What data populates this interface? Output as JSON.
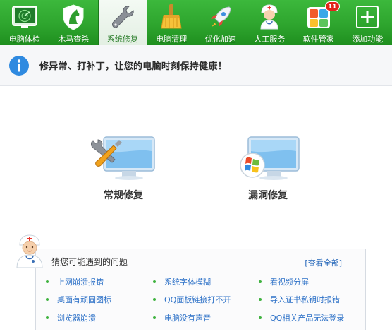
{
  "toolbar": {
    "items": [
      {
        "label": "电脑体检",
        "icon": "radar-monitor-icon"
      },
      {
        "label": "木马查杀",
        "icon": "horse-shield-icon"
      },
      {
        "label": "系统修复",
        "icon": "wrench-icon"
      },
      {
        "label": "电脑清理",
        "icon": "broom-icon"
      },
      {
        "label": "优化加速",
        "icon": "rocket-icon"
      },
      {
        "label": "人工服务",
        "icon": "doctor-icon"
      },
      {
        "label": "软件管家",
        "icon": "app-grid-icon",
        "badge": "11"
      },
      {
        "label": "添加功能",
        "icon": "plus-icon"
      }
    ],
    "active_index": 2
  },
  "info_bar": {
    "icon": "info-icon",
    "text": "修异常、打补丁，让您的电脑时刻保持健康！"
  },
  "repair_options": {
    "normal": {
      "label": "常规修复",
      "icon": "monitor-tools-icon"
    },
    "vulnerability": {
      "label": "漏洞修复",
      "icon": "monitor-windows-icon"
    }
  },
  "problems": {
    "title": "猜您可能遇到的问题",
    "view_all": "查看全部",
    "columns": [
      [
        "上网崩溃报错",
        "桌面有顽固图标",
        "浏览器崩溃"
      ],
      [
        "系统字体模糊",
        "QQ面板链接打不开",
        "电脑没有声音"
      ],
      [
        "看视频分屏",
        "导入证书私钥时报错",
        "QQ相关产品无法登录"
      ]
    ]
  },
  "colors": {
    "toolbar_green": "#2ea52e",
    "link_blue": "#2d71c7",
    "bullet_green": "#3fb23f",
    "badge_red": "#e2231a"
  }
}
